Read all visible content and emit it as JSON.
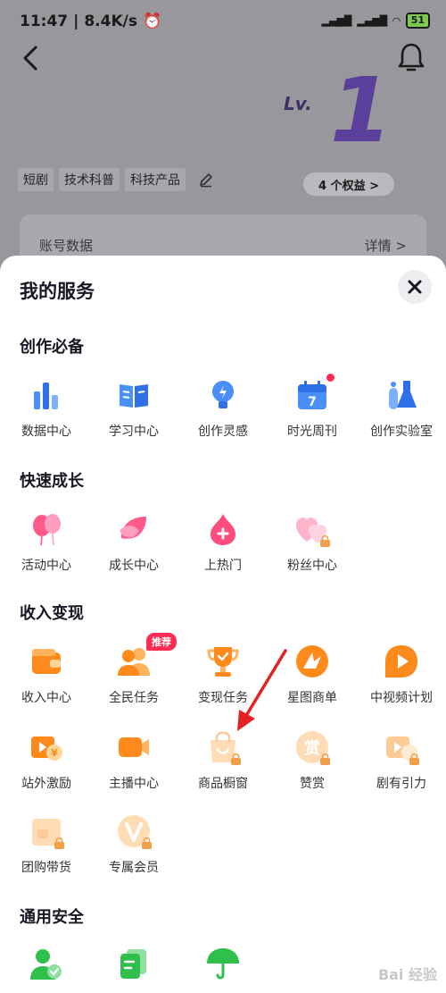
{
  "status_bar": {
    "time": "11:47",
    "speed": "8.4K/s",
    "battery": "51"
  },
  "header": {
    "level_prefix": "Lv.",
    "level_number": "1",
    "perks_label": "4 个权益 >",
    "tags": [
      "短剧",
      "技术科普",
      "科技产品"
    ],
    "account_label": "账号数据",
    "account_detail": "详情 >"
  },
  "sheet": {
    "title": "我的服务",
    "sections": [
      {
        "title": "创作必备",
        "items": [
          {
            "label": "数据中心",
            "icon": "bar-chart-icon",
            "color": "#3b82f6"
          },
          {
            "label": "学习中心",
            "icon": "book-icon",
            "color": "#3b82f6"
          },
          {
            "label": "创作灵感",
            "icon": "lightbulb-icon",
            "color": "#3b82f6"
          },
          {
            "label": "时光周刊",
            "icon": "calendar-icon",
            "color": "#3b82f6",
            "dot": true
          },
          {
            "label": "创作实验室",
            "icon": "flask-icon",
            "color": "#3b82f6"
          }
        ]
      },
      {
        "title": "快速成长",
        "items": [
          {
            "label": "活动中心",
            "icon": "balloon-icon",
            "color": "#ff4d7d"
          },
          {
            "label": "成长中心",
            "icon": "leaf-icon",
            "color": "#ff4d7d"
          },
          {
            "label": "上热门",
            "icon": "flame-icon",
            "color": "#ff4d7d"
          },
          {
            "label": "粉丝中心",
            "icon": "hearts-icon",
            "color": "#ff4d7d",
            "locked": true
          }
        ]
      },
      {
        "title": "收入变现",
        "items": [
          {
            "label": "收入中心",
            "icon": "wallet-icon",
            "color": "#ff8a1c"
          },
          {
            "label": "全民任务",
            "icon": "people-icon",
            "color": "#ff8a1c",
            "badge": "推荐"
          },
          {
            "label": "变现任务",
            "icon": "trophy-icon",
            "color": "#ff8a1c"
          },
          {
            "label": "星图商单",
            "icon": "star-map-icon",
            "color": "#ff8a1c"
          },
          {
            "label": "中视频计划",
            "icon": "play-icon",
            "color": "#ff8a1c"
          },
          {
            "label": "站外激励",
            "icon": "video-coin-icon",
            "color": "#ff8a1c"
          },
          {
            "label": "主播中心",
            "icon": "camera-icon",
            "color": "#ff8a1c"
          },
          {
            "label": "商品橱窗",
            "icon": "shopping-bag-icon",
            "color": "#ff8a1c",
            "locked": true
          },
          {
            "label": "赞赏",
            "icon": "appreciate-icon",
            "color": "#ff8a1c",
            "locked": true,
            "glyph": "赏"
          },
          {
            "label": "剧有引力",
            "icon": "drama-icon",
            "color": "#ff8a1c",
            "locked": true
          },
          {
            "label": "团购带货",
            "icon": "store-icon",
            "color": "#ff8a1c",
            "locked": true
          },
          {
            "label": "专属会员",
            "icon": "vip-icon",
            "color": "#ff8a1c",
            "locked": true
          }
        ]
      },
      {
        "title": "通用安全",
        "items": [
          {
            "label": "",
            "icon": "user-shield-icon",
            "color": "#2fbf4a"
          },
          {
            "label": "",
            "icon": "cards-icon",
            "color": "#2fbf4a"
          },
          {
            "label": "",
            "icon": "umbrella-icon",
            "color": "#2fbf4a"
          }
        ]
      }
    ]
  },
  "watermark": "Bai 经验"
}
